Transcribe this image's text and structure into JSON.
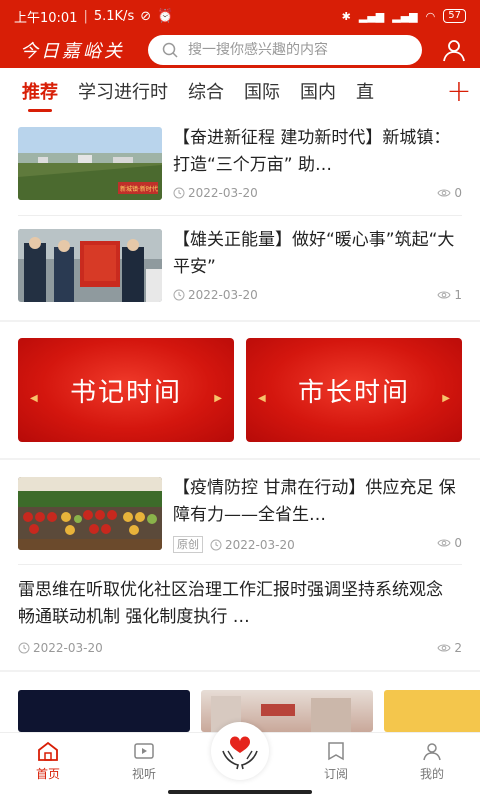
{
  "status_bar": {
    "time": "上午10:01",
    "net_speed": "5.1K/s",
    "battery": "57"
  },
  "header": {
    "logo": "今日嘉峪关",
    "search_placeholder": "搜一搜你感兴趣的内容"
  },
  "tabs": [
    "推荐",
    "学习进行时",
    "综合",
    "国际",
    "国内",
    "直"
  ],
  "news": [
    {
      "title": "【奋进新征程 建功新时代】新城镇：打造“三个万亩” 助…",
      "date": "2022-03-20",
      "views": "0"
    },
    {
      "title": "【雄关正能量】做好“暖心事”筑起“大平安”",
      "date": "2022-03-20",
      "views": "1"
    },
    {
      "title": "【疫情防控 甘肃在行动】供应充足 保障有力——全省生…",
      "tag": "原创",
      "date": "2022-03-20",
      "views": "0"
    },
    {
      "title": "雷思维在听取优化社区治理工作汇报时强调坚持系统观念 畅通联动机制 强化制度执行 …",
      "date": "2022-03-20",
      "views": "2"
    }
  ],
  "banners": [
    "书记时间",
    "市长时间"
  ],
  "thumb1_caption": "新城镇·新时代",
  "bottom_nav": {
    "home": "首页",
    "video": "视听",
    "subscribe": "订阅",
    "mine": "我的"
  },
  "colors": {
    "brand": "#d81e06"
  }
}
